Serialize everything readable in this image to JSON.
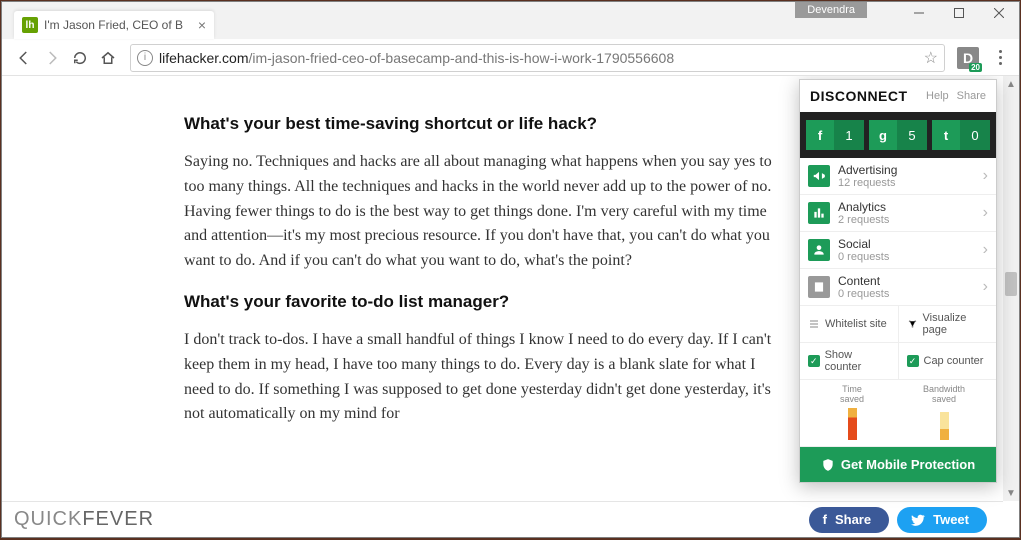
{
  "window": {
    "user_badge": "Devendra",
    "tab_title": "I'm Jason Fried, CEO of B"
  },
  "toolbar": {
    "url_host": "lifehacker.com",
    "url_path": "/im-jason-fried-ceo-of-basecamp-and-this-is-how-i-work-1790556608",
    "ext_badge": "20"
  },
  "article": {
    "h1": "What's your best time-saving shortcut or life hack?",
    "p1": "Saying no. Techniques and hacks are all about managing what happens when you say yes to too many things. All the techniques and hacks in the world never add up to the power of no. Having fewer things to do is the best way to get things done. I'm very careful with my time and attention—it's my most precious resource. If you don't have that, you can't do what you want to do. And if you can't do what you want to do, what's the point?",
    "h2": "What's your favorite to-do list manager?",
    "p2": "I don't track to-dos. I have a small handful of things I know I need to do every day. If I can't keep them in my head, I have too many things to do. Every day is a blank slate for what I need to do. If something I was supposed to get done yesterday didn't get done yesterday, it's not automatically on my mind for"
  },
  "panel": {
    "brand": "DISCONNECT",
    "help": "Help",
    "share": "Share",
    "counters": {
      "f": "1",
      "g": "5",
      "t": "0"
    },
    "cats": {
      "advertising": {
        "label": "Advertising",
        "sub": "12 requests"
      },
      "analytics": {
        "label": "Analytics",
        "sub": "2 requests"
      },
      "social": {
        "label": "Social",
        "sub": "0 requests"
      },
      "content": {
        "label": "Content",
        "sub": "0 requests"
      }
    },
    "tools": {
      "whitelist": "Whitelist site",
      "visualize": "Visualize page"
    },
    "checks": {
      "show": "Show counter",
      "cap": "Cap counter"
    },
    "stats": {
      "time": "Time\nsaved",
      "bandwidth": "Bandwidth\nsaved"
    },
    "cta": "Get Mobile Protection"
  },
  "footer": {
    "logo1": "QUICK",
    "logo2": "FEVER",
    "share": "Share",
    "tweet": "Tweet"
  }
}
